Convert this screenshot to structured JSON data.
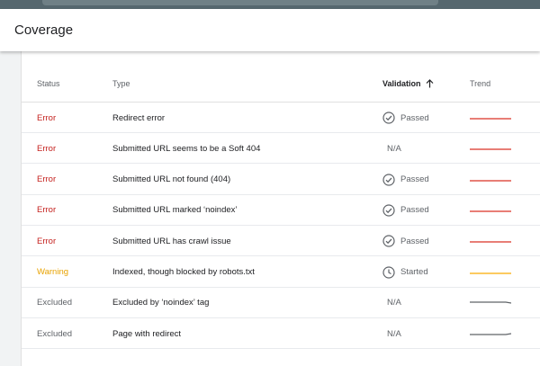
{
  "header": {
    "title": "Coverage"
  },
  "table": {
    "columns": {
      "status": "Status",
      "type": "Type",
      "validation": "Validation",
      "trend": "Trend"
    },
    "rows": [
      {
        "status": "Error",
        "status_kind": "error",
        "type": "Redirect error",
        "validation": "Passed",
        "validation_icon": "check-circle-icon",
        "trend_color": "#d93025",
        "trend_shape": "flat"
      },
      {
        "status": "Error",
        "status_kind": "error",
        "type": "Submitted URL seems to be a Soft 404",
        "validation": "N/A",
        "validation_icon": "",
        "trend_color": "#d93025",
        "trend_shape": "flat"
      },
      {
        "status": "Error",
        "status_kind": "error",
        "type": "Submitted URL not found (404)",
        "validation": "Passed",
        "validation_icon": "check-circle-icon",
        "trend_color": "#d93025",
        "trend_shape": "flat"
      },
      {
        "status": "Error",
        "status_kind": "error",
        "type": "Submitted URL marked ‘noindex’",
        "validation": "Passed",
        "validation_icon": "check-circle-icon",
        "trend_color": "#d93025",
        "trend_shape": "flat"
      },
      {
        "status": "Error",
        "status_kind": "error",
        "type": "Submitted URL has crawl issue",
        "validation": "Passed",
        "validation_icon": "check-circle-icon",
        "trend_color": "#d93025",
        "trend_shape": "flat"
      },
      {
        "status": "Warning",
        "status_kind": "warning",
        "type": "Indexed, though blocked by robots.txt",
        "validation": "Started",
        "validation_icon": "clock-icon",
        "trend_color": "#f9ab00",
        "trend_shape": "flat"
      },
      {
        "status": "Excluded",
        "status_kind": "excluded",
        "type": "Excluded by ‘noindex’ tag",
        "validation": "N/A",
        "validation_icon": "",
        "trend_color": "#5f6368",
        "trend_shape": "down-end"
      },
      {
        "status": "Excluded",
        "status_kind": "excluded",
        "type": "Page with redirect",
        "validation": "N/A",
        "validation_icon": "",
        "trend_color": "#5f6368",
        "trend_shape": "up-end"
      }
    ]
  }
}
